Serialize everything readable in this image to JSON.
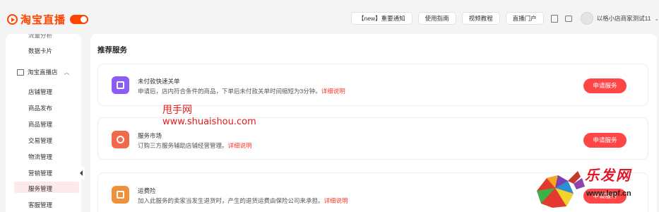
{
  "app": {
    "brand": "淘宝直播"
  },
  "topnav": {
    "items": [
      {
        "label": "【new】重要通知"
      },
      {
        "label": "使用指南"
      },
      {
        "label": "视频教程"
      },
      {
        "label": "直播门户"
      }
    ],
    "user_name": "以格小店商家测试11",
    "icons": [
      "document-icon",
      "chat-icon",
      "chevron-down-icon"
    ]
  },
  "sidebar": {
    "partial_top": "流量分析",
    "items_top": [
      {
        "label": "数据卡片"
      }
    ],
    "group": {
      "label": "淘宝直播店",
      "icon": "store-icon",
      "expanded": true
    },
    "items": [
      {
        "label": "店铺管理"
      },
      {
        "label": "商品发布"
      },
      {
        "label": "商品管理"
      },
      {
        "label": "交易管理"
      },
      {
        "label": "物流管理"
      },
      {
        "label": "营销管理"
      },
      {
        "label": "服务管理",
        "active": true
      },
      {
        "label": "客服管理"
      }
    ]
  },
  "main": {
    "title": "推荐服务",
    "cards": [
      {
        "title": "未付款快速关单",
        "desc": "申请后，店内符合条件的商品，下单后未付款关单时间缩短为3分钟。",
        "link": "详细说明",
        "button": "申请服务",
        "icon": "document-check-icon",
        "icon_color": "#8b5cf6"
      },
      {
        "title": "服务市场",
        "desc": "订购三方服务辅助店铺经营管理。",
        "link": "详细说明",
        "button": "申请服务",
        "icon": "service-person-icon",
        "icon_color": "#f26a4b"
      },
      {
        "title": "运费险",
        "desc": "加入此服务的卖家当发生退货时，产生的退货运费由保险公司来承担。",
        "link": "详细说明",
        "button": "申请服务",
        "icon": "shipping-insurance-icon",
        "icon_color": "#f0903a"
      }
    ]
  },
  "watermarks": {
    "line1": "甩手网",
    "line2": "www.shuaishou.com",
    "logo_cn": "乐发网",
    "logo_url": "www.lepf.cn"
  },
  "colors": {
    "accent": "#ff4400",
    "button": "#ff4545",
    "link": "#ff3b30",
    "active_bg": "#fde8ea"
  }
}
